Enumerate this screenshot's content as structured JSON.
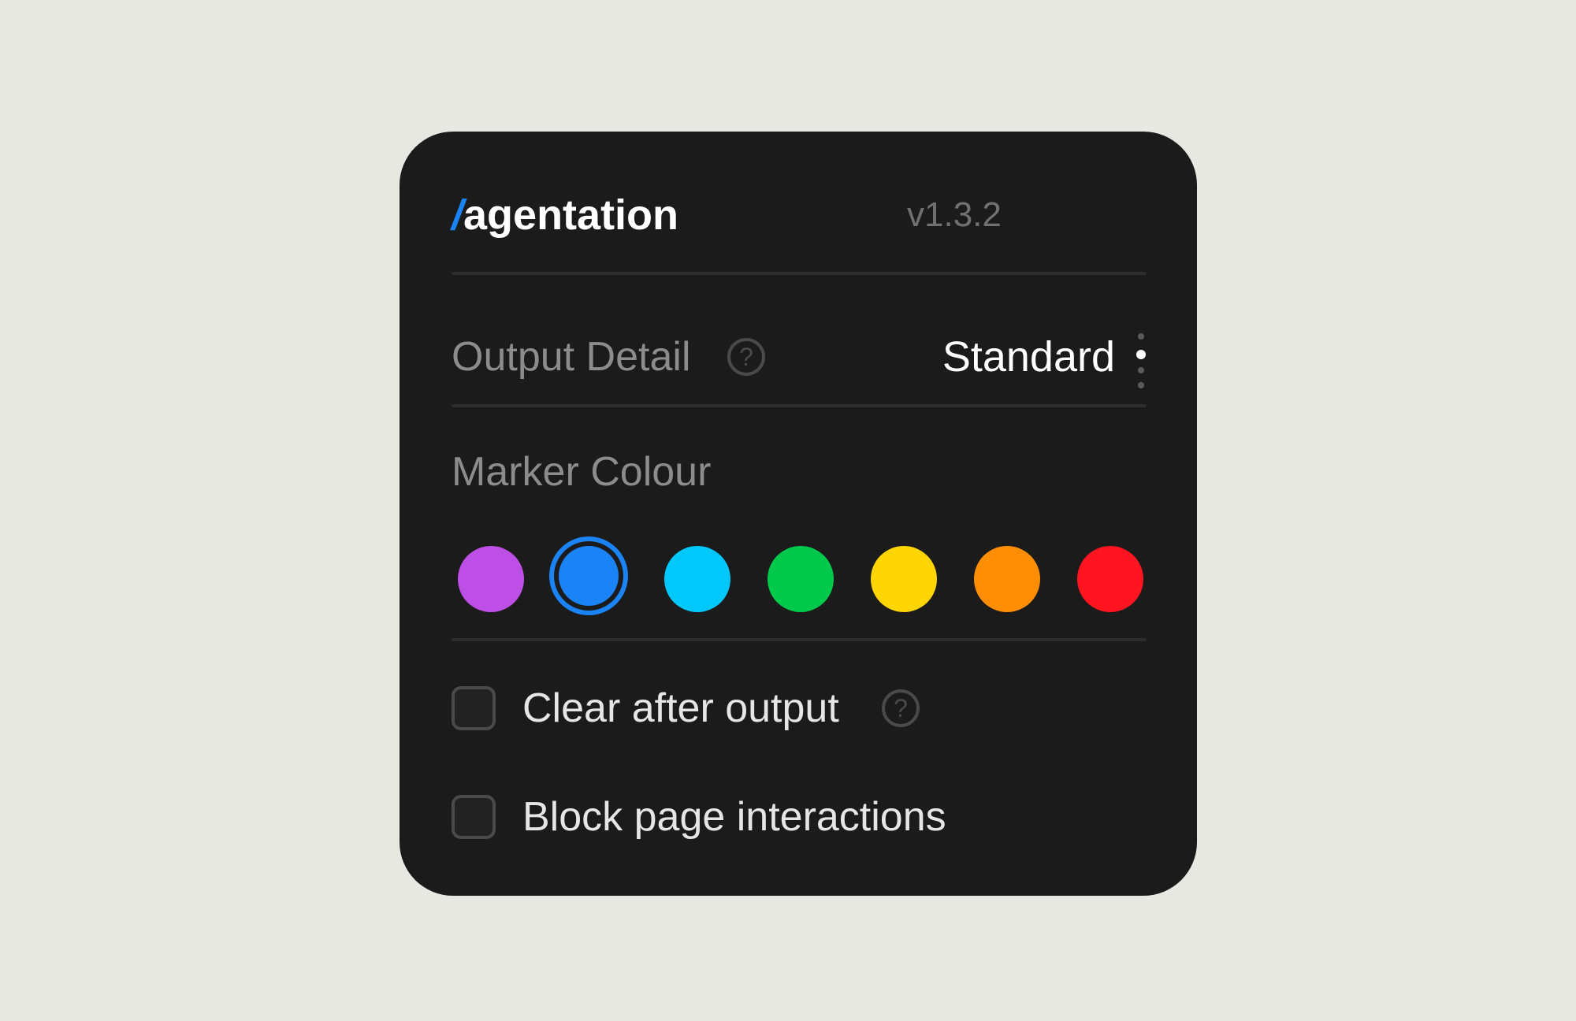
{
  "panel": {
    "brand_slash": "/",
    "brand_name": "agentation",
    "version": "v1.3.2"
  },
  "output_detail": {
    "label": "Output Detail",
    "help_icon": "question-circle-icon",
    "value": "Standard",
    "options_indicator": "vertical-dots-icon"
  },
  "marker_colour": {
    "label": "Marker Colour",
    "options": [
      {
        "name": "purple",
        "color": "#bd4ee6",
        "selected": false
      },
      {
        "name": "blue",
        "color": "#1a84f6",
        "selected": true
      },
      {
        "name": "cyan",
        "color": "#00c8fa",
        "selected": false
      },
      {
        "name": "green",
        "color": "#00c94b",
        "selected": false
      },
      {
        "name": "yellow",
        "color": "#ffd504",
        "selected": false
      },
      {
        "name": "orange",
        "color": "#ff8e05",
        "selected": false
      },
      {
        "name": "red",
        "color": "#ff1420",
        "selected": false
      }
    ]
  },
  "options": {
    "clear_after_output": {
      "label": "Clear after output",
      "checked": false,
      "help_icon": "question-circle-icon"
    },
    "block_page_interactions": {
      "label": "Block page interactions",
      "checked": false
    }
  },
  "colors": {
    "page_background": "#e8e8e3",
    "panel_background": "#1b1b1b",
    "accent": "#1a84f6"
  }
}
